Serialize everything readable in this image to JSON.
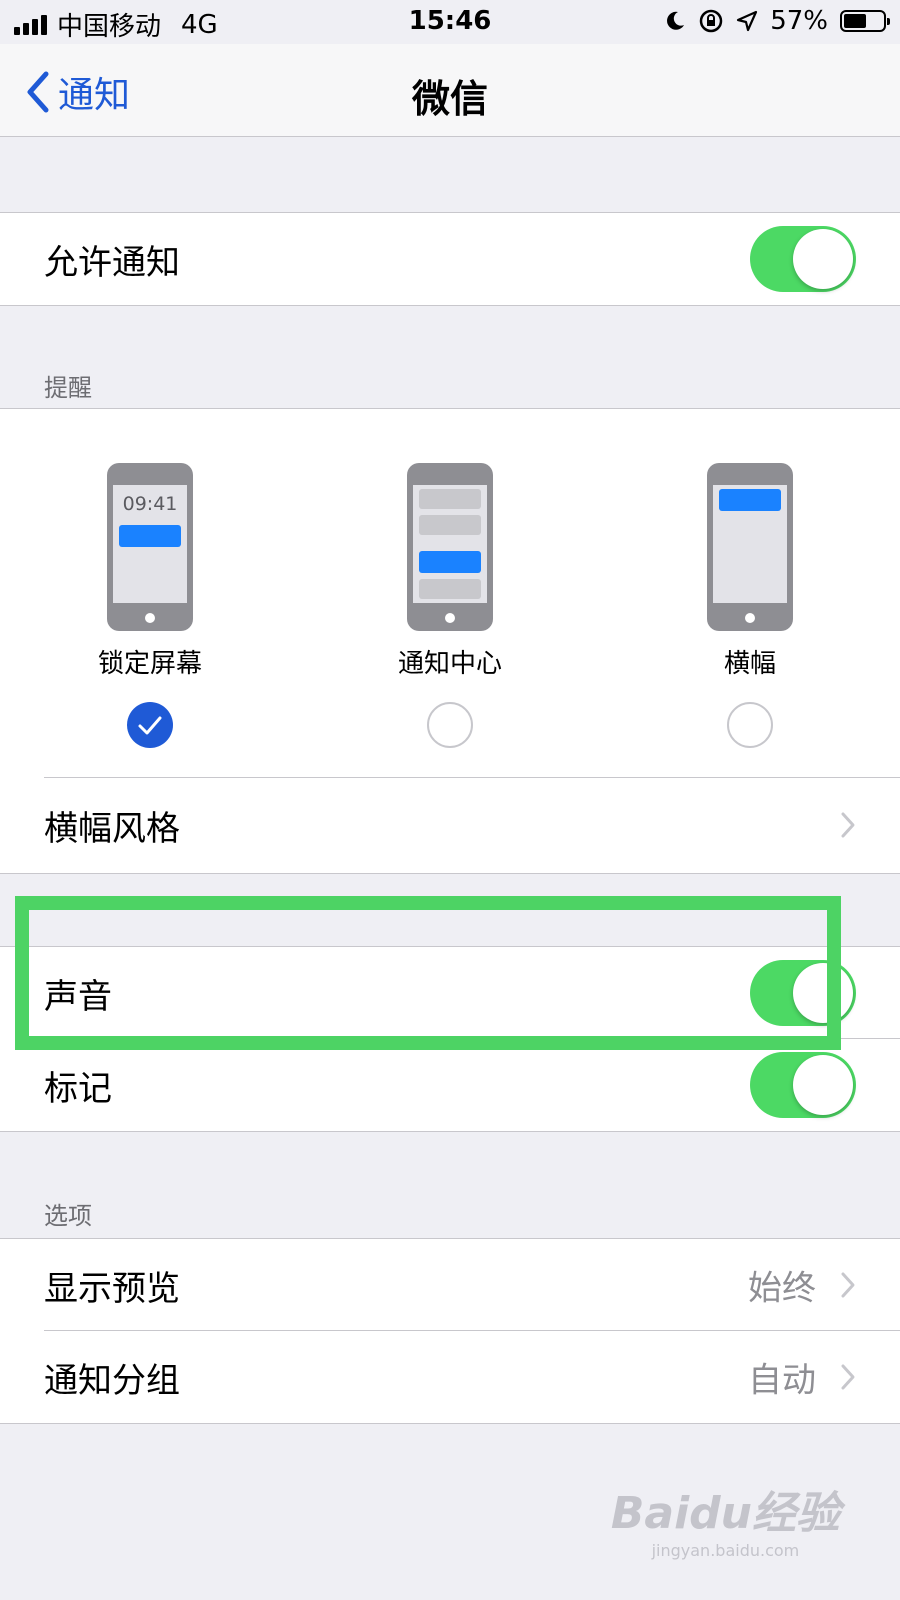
{
  "status_bar": {
    "carrier": "中国移动",
    "network": "4G",
    "time": "15:46",
    "battery_percent": "57%",
    "battery_level": 0.57,
    "icons": [
      "moon-icon",
      "orientation-lock-icon",
      "location-icon"
    ]
  },
  "nav": {
    "back_label": "通知",
    "title": "微信"
  },
  "allow_notifications": {
    "label": "允许通知",
    "on": true
  },
  "alerts": {
    "header": "提醒",
    "styles": [
      {
        "label": "锁定屏幕",
        "phone_time": "09:41",
        "selected": true
      },
      {
        "label": "通知中心",
        "selected": false
      },
      {
        "label": "横幅",
        "selected": false
      }
    ],
    "banner_style_label": "横幅风格"
  },
  "sounds": {
    "label": "声音",
    "on": true
  },
  "badges": {
    "label": "标记",
    "on": true
  },
  "options": {
    "header": "选项",
    "show_previews": {
      "label": "显示预览",
      "value": "始终"
    },
    "grouping": {
      "label": "通知分组",
      "value": "自动"
    }
  },
  "highlight_color": "#4dd364",
  "accent_color": "#1f5ad6",
  "toggle_color": "#4cd964",
  "watermark": {
    "logo": "Baidu经验",
    "url": "jingyan.baidu.com"
  }
}
